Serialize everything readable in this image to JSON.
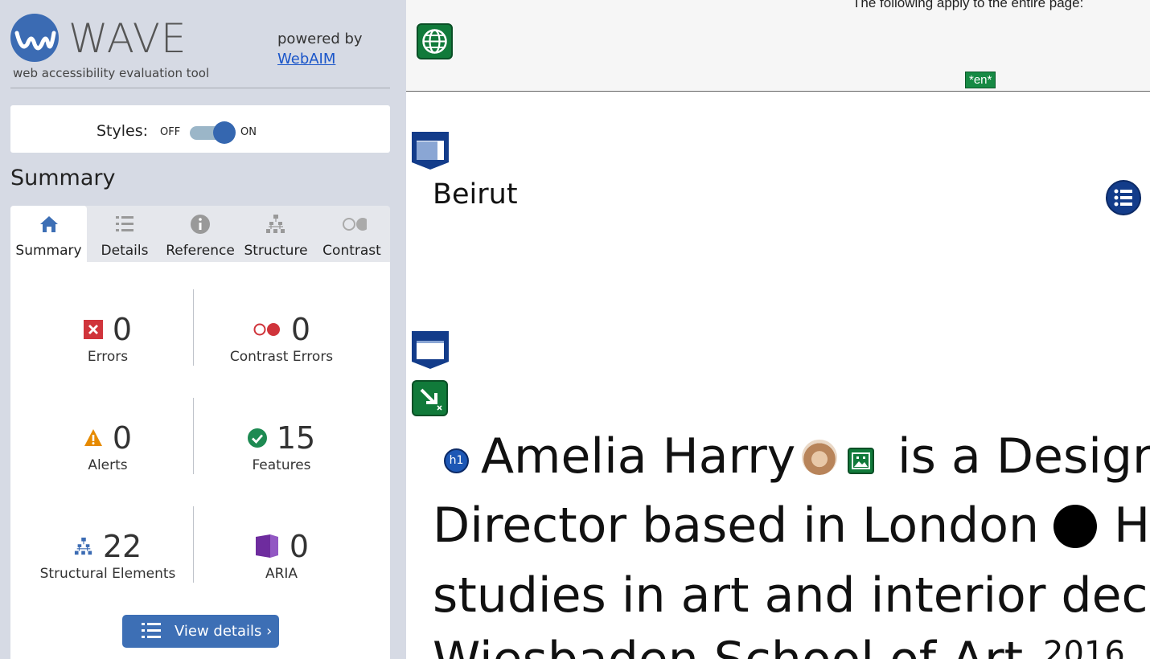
{
  "wave": {
    "logo_text": "WAVE",
    "tagline": "web accessibility evaluation tool",
    "powered_by": "powered by",
    "webaim_link": "WebAIM"
  },
  "styles": {
    "label": "Styles:",
    "off": "OFF",
    "on": "ON",
    "state": "ON"
  },
  "summary_heading": "Summary",
  "tabs": [
    {
      "label": "Summary",
      "icon": "home-icon",
      "active": true
    },
    {
      "label": "Details",
      "icon": "list-icon",
      "active": false
    },
    {
      "label": "Reference",
      "icon": "info-icon",
      "active": false
    },
    {
      "label": "Structure",
      "icon": "structure-icon",
      "active": false
    },
    {
      "label": "Contrast",
      "icon": "contrast-icon",
      "active": false
    }
  ],
  "stats": {
    "errors": {
      "value": "0",
      "label": "Errors",
      "icon": "error-icon",
      "color": "#d0343b"
    },
    "contrast_errors": {
      "value": "0",
      "label": "Contrast Errors",
      "icon": "contrast-error-icon",
      "color": "#d0343b"
    },
    "alerts": {
      "value": "0",
      "label": "Alerts",
      "icon": "alert-icon",
      "color": "#e68a00"
    },
    "features": {
      "value": "15",
      "label": "Features",
      "icon": "feature-check-icon",
      "color": "#1d8a52"
    },
    "structural": {
      "value": "22",
      "label": "Structural Elements",
      "icon": "structure-icon",
      "color": "#3b6bb3"
    },
    "aria": {
      "value": "0",
      "label": "ARIA",
      "icon": "aria-icon",
      "color": "#6e2c9e"
    }
  },
  "view_details": "View details ›",
  "page": {
    "apply_text": "The following apply to the entire page:",
    "lang_badge": "*en*",
    "site_title": "Beirut",
    "h1_badge": "h1",
    "hero_name": "Amelia Harry",
    "hero_line1_rest": "is a Design",
    "hero_line2a": "Director based in London",
    "hero_line2b": "H",
    "hero_line3": "studies in art and interior deco",
    "hero_line4": "Wiesbaden School of Art",
    "hero_year": "2016"
  },
  "colors": {
    "sidebar_bg": "#d6dae4",
    "accent_blue": "#3d6fb5",
    "feature_green": "#117a3a",
    "structure_navy": "#133c8a"
  }
}
